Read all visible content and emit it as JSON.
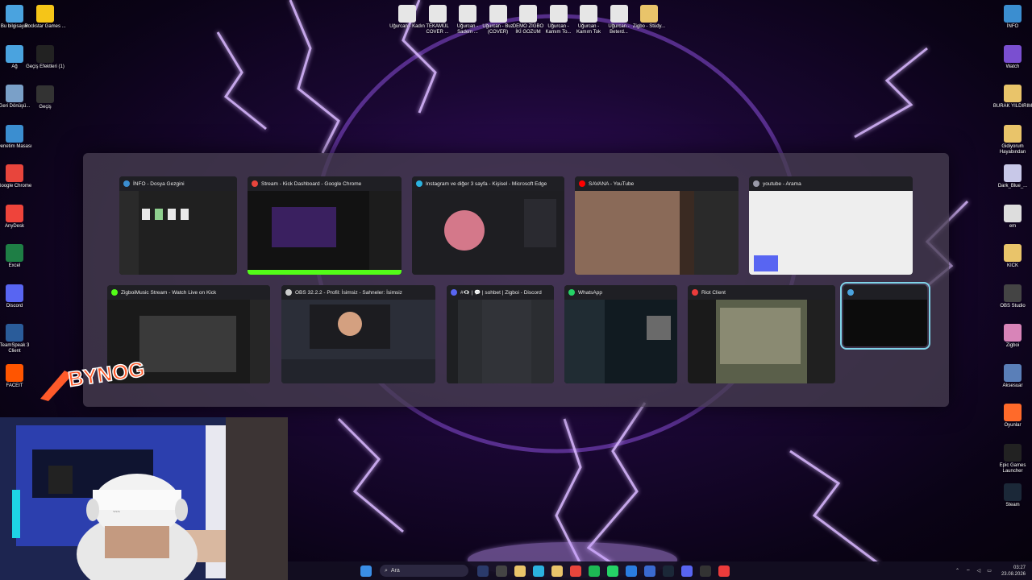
{
  "desktop": {
    "left_icons": [
      {
        "label": "Bu bilgisayar",
        "icon": "computer-icon",
        "color": "#4aa3df"
      },
      {
        "label": "Ağ",
        "icon": "network-icon",
        "color": "#4aa3df"
      },
      {
        "label": "Geri Dönüşü...",
        "icon": "recycle-bin-icon",
        "color": "#7aa0c8"
      },
      {
        "label": "Denetim Masası",
        "icon": "control-panel-icon",
        "color": "#3b8ed0"
      },
      {
        "label": "Google Chrome",
        "icon": "chrome-icon",
        "color": "#e8453c"
      },
      {
        "label": "AnyDesk",
        "icon": "anydesk-icon",
        "color": "#ef443b"
      },
      {
        "label": "Excel",
        "icon": "excel-icon",
        "color": "#1e7e45"
      },
      {
        "label": "Discord",
        "icon": "discord-icon",
        "color": "#5865f2"
      },
      {
        "label": "TeamSpeak 3 Client",
        "icon": "teamspeak-icon",
        "color": "#2a5c9a"
      },
      {
        "label": "FACEIT",
        "icon": "faceit-icon",
        "color": "#ff5500"
      }
    ],
    "left_icons_col2": [
      {
        "label": "Rockstar Games ...",
        "icon": "rockstar-icon",
        "color": "#f5c518"
      },
      {
        "label": "Geçiş Efektleri (1)",
        "icon": "folder-icon",
        "color": "#222"
      },
      {
        "label": "Geçiş",
        "icon": "film-icon",
        "color": "#333"
      }
    ],
    "top_icons": [
      {
        "label": "Uğurcan - Kadın",
        "icon": "video-file-icon"
      },
      {
        "label": "TEKAMÜL COVER ...",
        "icon": "video-file-icon"
      },
      {
        "label": "Uğurcan - Sadem ...",
        "icon": "video-file-icon"
      },
      {
        "label": "Uğurcan - Buz (COVER)",
        "icon": "video-file-icon"
      },
      {
        "label": "DEMO ZİGBO İKİ GOZUM",
        "icon": "video-file-icon"
      },
      {
        "label": "Uğurcan - Kamım To...",
        "icon": "video-file-icon"
      },
      {
        "label": "Uğurcan - Kamım Tok",
        "icon": "video-file-icon"
      },
      {
        "label": "Uğurcan - Beterd...",
        "icon": "video-file-icon"
      },
      {
        "label": "Zigbo - Stüdy...",
        "icon": "folder-icon"
      }
    ],
    "right_icons": [
      {
        "label": "İNFO",
        "icon": "info-icon",
        "color": "#3b8ed0"
      },
      {
        "label": "Watch",
        "icon": "video-icon",
        "color": "#7a4fd0"
      },
      {
        "label": "BURAK YILDIRIM",
        "icon": "folder-icon",
        "color": "#e9c46a"
      },
      {
        "label": "Gidiyorum Hayabından",
        "icon": "folder-icon",
        "color": "#e9c46a"
      },
      {
        "label": "Dark_Blue_...",
        "icon": "folder-icon",
        "color": "#c8c8e8"
      },
      {
        "label": "em",
        "icon": "file-icon",
        "color": "#ddd"
      },
      {
        "label": "KICK",
        "icon": "folder-icon",
        "color": "#e9c46a"
      },
      {
        "label": "OBS Studio",
        "icon": "obs-icon",
        "color": "#444"
      },
      {
        "label": "Zigboi",
        "icon": "folder-icon",
        "color": "#d884b8"
      },
      {
        "label": "Aksesuar",
        "icon": "gear-icon",
        "color": "#5a7fb8"
      },
      {
        "label": "Oyunlar",
        "icon": "close-x-icon",
        "color": "#ff6a2a"
      },
      {
        "label": "Epic Games Launcher",
        "icon": "epic-icon",
        "color": "#222"
      },
      {
        "label": "Steam",
        "icon": "steam-icon",
        "color": "#1b2838"
      }
    ]
  },
  "switcher": {
    "row1": [
      {
        "title": "İNFO - Dosya Gezgini",
        "icon_color": "#3b8ed0",
        "theme": "explorer"
      },
      {
        "title": "Stream - Kick Dashboard - Google Chrome",
        "icon_color": "#e8453c",
        "theme": "kick"
      },
      {
        "title": "Instagram ve diğer 3 sayfa - Kişisel - Microsoft Edge",
        "icon_color": "#2bb3e0",
        "theme": "instagram"
      },
      {
        "title": "SAVANA - YouTube",
        "icon_color": "#ff0000",
        "theme": "youtube"
      },
      {
        "title": "youtube - Arama",
        "icon_color": "#9a9aa8",
        "theme": "search"
      }
    ],
    "row2": [
      {
        "title": "ZigboiMusic Stream - Watch Live on Kick",
        "icon_color": "#53fc18",
        "theme": "kickwatch"
      },
      {
        "title": "OBS 32.2.2 - Profil: İsimsiz - Sahneler: İsimsiz",
        "icon_color": "#ccc",
        "theme": "obs"
      },
      {
        "title": "#👁‍🗨 | 💬 | sohbet | Zigboi - Discord",
        "icon_color": "#5865f2",
        "theme": "discord"
      },
      {
        "title": "WhatsApp",
        "icon_color": "#25d366",
        "theme": "whatsapp"
      },
      {
        "title": "Riot Client",
        "icon_color": "#eb3b3b",
        "theme": "riot"
      },
      {
        "title": "",
        "icon_color": "#4aa3df",
        "theme": "terminal"
      }
    ]
  },
  "overlay": {
    "logo_text": "BYNOG"
  },
  "taskbar": {
    "search_placeholder": "Ara",
    "items": [
      "widgets-icon",
      "task-view-icon",
      "file-explorer-icon",
      "edge-icon",
      "folder-icon",
      "chrome-icon",
      "spotify-icon",
      "whatsapp-icon",
      "mail-icon",
      "store-icon",
      "steam-icon",
      "discord-icon",
      "obs-icon",
      "riot-icon"
    ],
    "time": "03:27",
    "date": "23.08.2026"
  }
}
